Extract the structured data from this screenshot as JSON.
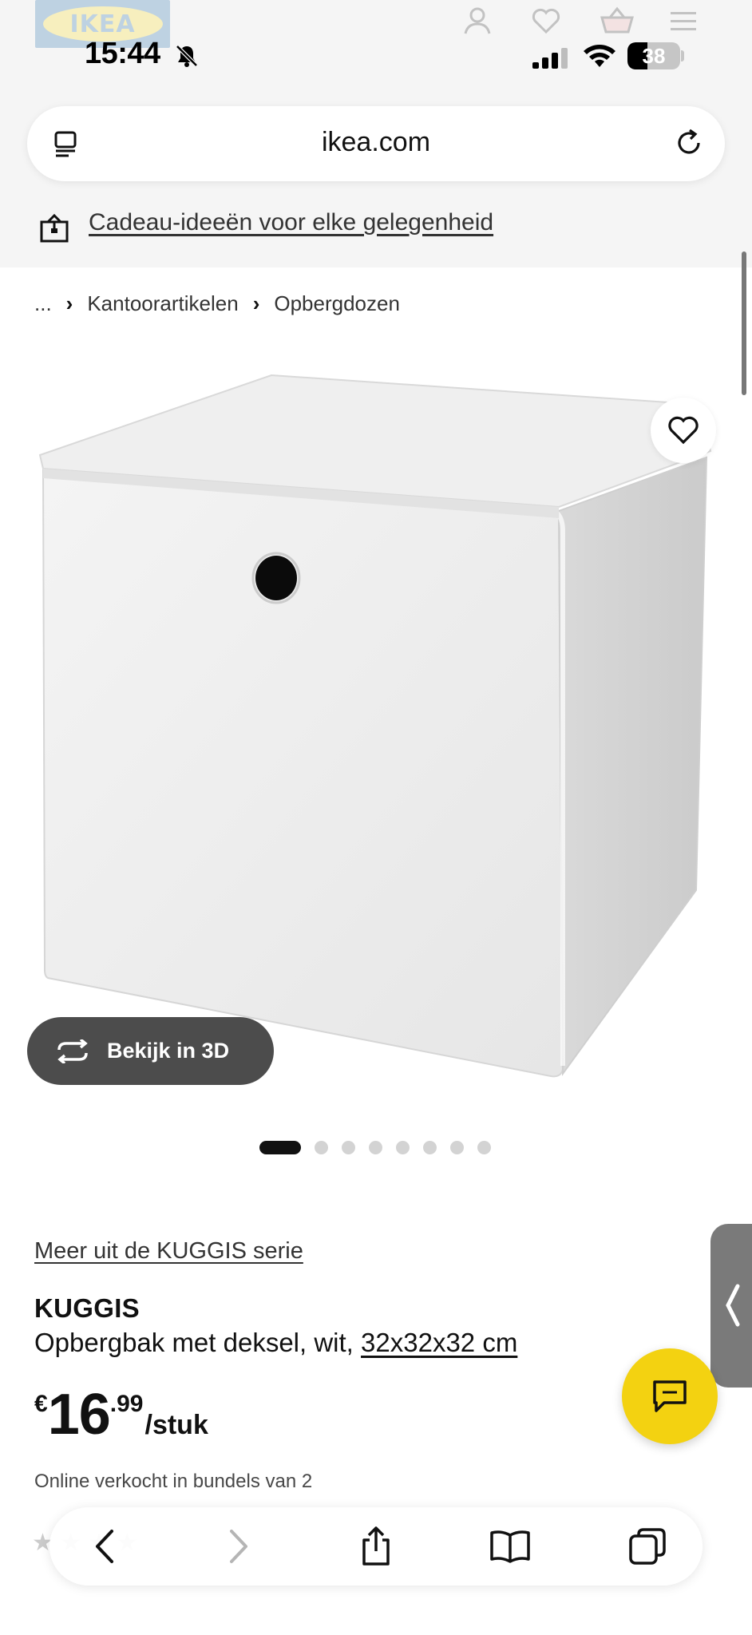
{
  "status_bar": {
    "time": "15:44",
    "battery": "38"
  },
  "header": {
    "logo_text": "IKEA"
  },
  "browser": {
    "url": "ikea.com"
  },
  "promo": {
    "link": "Cadeau-ideeën voor elke gelegenheid"
  },
  "breadcrumb": {
    "items": [
      "...",
      "Kantoorartikelen",
      "Opbergdozen"
    ]
  },
  "gallery": {
    "view_3d_label": "Bekijk in 3D",
    "dot_count": 8,
    "active_dot": 1
  },
  "product": {
    "series_link": "Meer uit de KUGGIS serie",
    "name": "KUGGIS",
    "description": "Opbergbak met deksel, wit, ",
    "size": "32x32x32 cm",
    "price_currency": "€",
    "price_integer": "16",
    "price_decimal": ".99",
    "price_unit": "/stuk",
    "bundle_note": "Online verkocht in bundels van 2"
  },
  "colors": {
    "ikea_blue": "#0058a3",
    "ikea_yellow": "#ffdb00",
    "chat_button": "#f3d211",
    "view_3d_bg": "#4c4c4c"
  }
}
